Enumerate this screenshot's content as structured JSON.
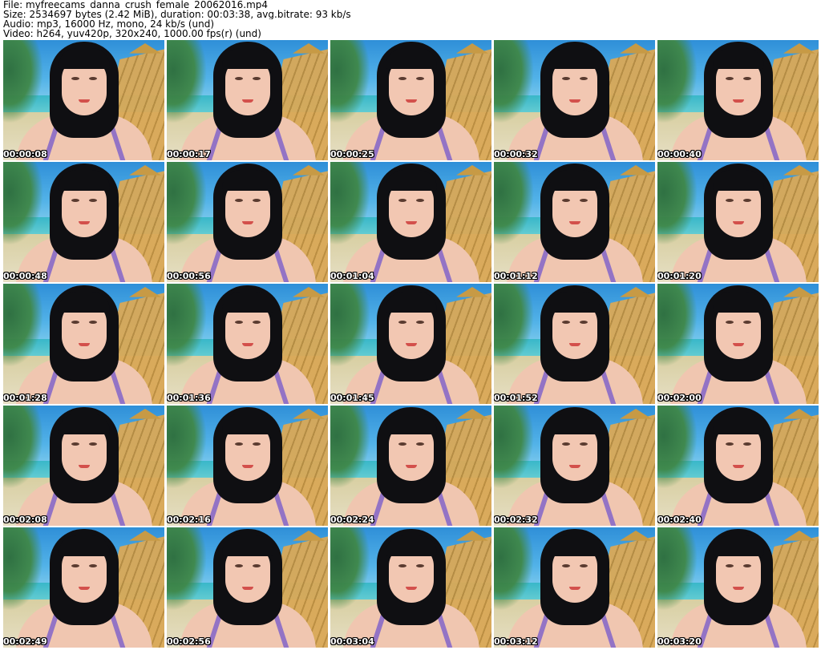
{
  "header": {
    "file": "File: myfreecams_danna_crush_female_20062016.mp4",
    "size": "Size: 2534697 bytes (2.42 MiB), duration: 00:03:38, avg.bitrate: 93 kb/s",
    "audio": "Audio: mp3, 16000 Hz, mono, 24 kb/s (und)",
    "video": "Video: h264, yuv420p, 320x240, 1000.00 fps(r) (und)"
  },
  "thumbnails": [
    {
      "timestamp": "00:00:08"
    },
    {
      "timestamp": "00:00:17"
    },
    {
      "timestamp": "00:00:25"
    },
    {
      "timestamp": "00:00:32"
    },
    {
      "timestamp": "00:00:40"
    },
    {
      "timestamp": "00:00:48"
    },
    {
      "timestamp": "00:00:56"
    },
    {
      "timestamp": "00:01:04"
    },
    {
      "timestamp": "00:01:12"
    },
    {
      "timestamp": "00:01:20"
    },
    {
      "timestamp": "00:01:28"
    },
    {
      "timestamp": "00:01:36"
    },
    {
      "timestamp": "00:01:45"
    },
    {
      "timestamp": "00:01:52"
    },
    {
      "timestamp": "00:02:00"
    },
    {
      "timestamp": "00:02:08"
    },
    {
      "timestamp": "00:02:16"
    },
    {
      "timestamp": "00:02:24"
    },
    {
      "timestamp": "00:02:32"
    },
    {
      "timestamp": "00:02:40"
    },
    {
      "timestamp": "00:02:49"
    },
    {
      "timestamp": "00:02:56"
    },
    {
      "timestamp": "00:03:04"
    },
    {
      "timestamp": "00:03:12"
    },
    {
      "timestamp": "00:03:20"
    }
  ]
}
